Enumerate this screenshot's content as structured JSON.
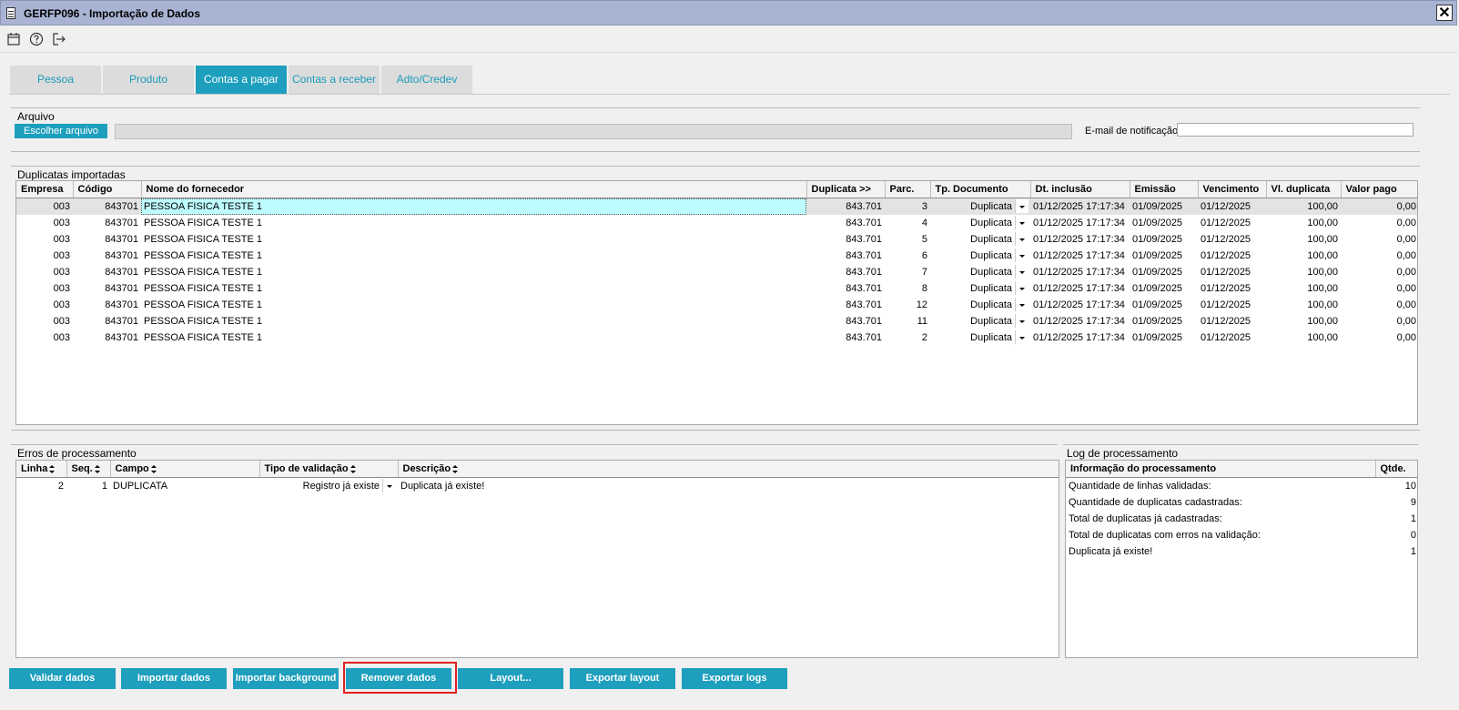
{
  "window": {
    "title": "GERFP096 - Importação de Dados",
    "close_label": "✕"
  },
  "toolbar": {
    "icons": [
      "calendar-icon",
      "help-icon",
      "exit-icon"
    ]
  },
  "tabs": [
    "Pessoa",
    "Produto",
    "Contas a pagar",
    "Contas a receber",
    "Adto/Credev"
  ],
  "active_tab": "Contas a pagar",
  "arquivo": {
    "section_title": "Arquivo",
    "choose_button": "Escolher arquivo",
    "file_value": "",
    "email_label": "E-mail de notificação",
    "email_value": ""
  },
  "duplicatas": {
    "section_title": "Duplicatas importadas",
    "columns": [
      "Empresa",
      "Código",
      "Nome do fornecedor",
      "Duplicata >>",
      "Parc.",
      "Tp. Documento",
      "Dt. inclusão",
      "Emissão",
      "Vencimento",
      "Vl. duplicata",
      "Valor pago"
    ],
    "rows": [
      [
        "003",
        "843701",
        "PESSOA FISICA TESTE 1",
        "843.701",
        "3",
        "Duplicata",
        "01/12/2025 17:17:34",
        "01/09/2025",
        "01/12/2025",
        "100,00",
        "0,00"
      ],
      [
        "003",
        "843701",
        "PESSOA FISICA TESTE 1",
        "843.701",
        "4",
        "Duplicata",
        "01/12/2025 17:17:34",
        "01/09/2025",
        "01/12/2025",
        "100,00",
        "0,00"
      ],
      [
        "003",
        "843701",
        "PESSOA FISICA TESTE 1",
        "843.701",
        "5",
        "Duplicata",
        "01/12/2025 17:17:34",
        "01/09/2025",
        "01/12/2025",
        "100,00",
        "0,00"
      ],
      [
        "003",
        "843701",
        "PESSOA FISICA TESTE 1",
        "843.701",
        "6",
        "Duplicata",
        "01/12/2025 17:17:34",
        "01/09/2025",
        "01/12/2025",
        "100,00",
        "0,00"
      ],
      [
        "003",
        "843701",
        "PESSOA FISICA TESTE 1",
        "843.701",
        "7",
        "Duplicata",
        "01/12/2025 17:17:34",
        "01/09/2025",
        "01/12/2025",
        "100,00",
        "0,00"
      ],
      [
        "003",
        "843701",
        "PESSOA FISICA TESTE 1",
        "843.701",
        "8",
        "Duplicata",
        "01/12/2025 17:17:34",
        "01/09/2025",
        "01/12/2025",
        "100,00",
        "0,00"
      ],
      [
        "003",
        "843701",
        "PESSOA FISICA TESTE 1",
        "843.701",
        "12",
        "Duplicata",
        "01/12/2025 17:17:34",
        "01/09/2025",
        "01/12/2025",
        "100,00",
        "0,00"
      ],
      [
        "003",
        "843701",
        "PESSOA FISICA TESTE 1",
        "843.701",
        "11",
        "Duplicata",
        "01/12/2025 17:17:34",
        "01/09/2025",
        "01/12/2025",
        "100,00",
        "0,00"
      ],
      [
        "003",
        "843701",
        "PESSOA FISICA TESTE 1",
        "843.701",
        "2",
        "Duplicata",
        "01/12/2025 17:17:34",
        "01/09/2025",
        "01/12/2025",
        "100,00",
        "0,00"
      ]
    ]
  },
  "erros": {
    "section_title": "Erros de processamento",
    "columns": [
      "Linha",
      "Seq.",
      "Campo",
      "Tipo de validação",
      "Descrição"
    ],
    "rows": [
      [
        "2",
        "1",
        "DUPLICATA",
        "Registro já existe",
        "Duplicata já existe!"
      ]
    ]
  },
  "log": {
    "section_title": "Log de processamento",
    "columns": [
      "Informação do processamento",
      "Qtde."
    ],
    "rows": [
      [
        "Quantidade de linhas validadas:",
        "10"
      ],
      [
        "Quantidade de duplicatas cadastradas:",
        "9"
      ],
      [
        "Total de duplicatas já cadastradas:",
        "1"
      ],
      [
        "Total de duplicatas com erros na validação:",
        "0"
      ],
      [
        "Duplicata já existe!",
        "1"
      ]
    ]
  },
  "buttons": [
    "Validar dados",
    "Importar dados",
    "Importar background",
    "Remover dados",
    "Layout...",
    "Exportar layout",
    "Exportar logs"
  ],
  "colors": {
    "accent": "#1e9fbd",
    "titlebar": "#a9b4d4",
    "highlight": "#e02020",
    "selected_cell": "#bffcff"
  }
}
